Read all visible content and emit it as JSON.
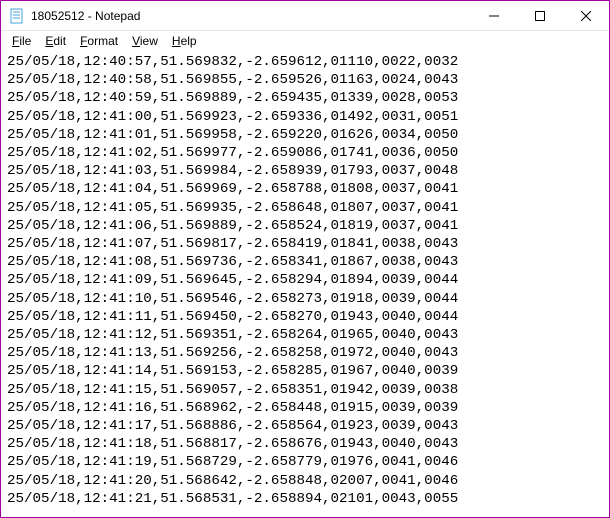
{
  "window": {
    "title": "18052512 - Notepad"
  },
  "menu": {
    "file": "File",
    "edit": "Edit",
    "format": "Format",
    "view": "View",
    "help": "Help"
  },
  "rows": [
    {
      "date": "25/05/18",
      "time": "12:40:57",
      "lat": "51.569832",
      "lon": "-2.659612",
      "c1": "01110",
      "c2": "0022",
      "c3": "0032"
    },
    {
      "date": "25/05/18",
      "time": "12:40:58",
      "lat": "51.569855",
      "lon": "-2.659526",
      "c1": "01163",
      "c2": "0024",
      "c3": "0043"
    },
    {
      "date": "25/05/18",
      "time": "12:40:59",
      "lat": "51.569889",
      "lon": "-2.659435",
      "c1": "01339",
      "c2": "0028",
      "c3": "0053"
    },
    {
      "date": "25/05/18",
      "time": "12:41:00",
      "lat": "51.569923",
      "lon": "-2.659336",
      "c1": "01492",
      "c2": "0031",
      "c3": "0051"
    },
    {
      "date": "25/05/18",
      "time": "12:41:01",
      "lat": "51.569958",
      "lon": "-2.659220",
      "c1": "01626",
      "c2": "0034",
      "c3": "0050"
    },
    {
      "date": "25/05/18",
      "time": "12:41:02",
      "lat": "51.569977",
      "lon": "-2.659086",
      "c1": "01741",
      "c2": "0036",
      "c3": "0050"
    },
    {
      "date": "25/05/18",
      "time": "12:41:03",
      "lat": "51.569984",
      "lon": "-2.658939",
      "c1": "01793",
      "c2": "0037",
      "c3": "0048"
    },
    {
      "date": "25/05/18",
      "time": "12:41:04",
      "lat": "51.569969",
      "lon": "-2.658788",
      "c1": "01808",
      "c2": "0037",
      "c3": "0041"
    },
    {
      "date": "25/05/18",
      "time": "12:41:05",
      "lat": "51.569935",
      "lon": "-2.658648",
      "c1": "01807",
      "c2": "0037",
      "c3": "0041"
    },
    {
      "date": "25/05/18",
      "time": "12:41:06",
      "lat": "51.569889",
      "lon": "-2.658524",
      "c1": "01819",
      "c2": "0037",
      "c3": "0041"
    },
    {
      "date": "25/05/18",
      "time": "12:41:07",
      "lat": "51.569817",
      "lon": "-2.658419",
      "c1": "01841",
      "c2": "0038",
      "c3": "0043"
    },
    {
      "date": "25/05/18",
      "time": "12:41:08",
      "lat": "51.569736",
      "lon": "-2.658341",
      "c1": "01867",
      "c2": "0038",
      "c3": "0043"
    },
    {
      "date": "25/05/18",
      "time": "12:41:09",
      "lat": "51.569645",
      "lon": "-2.658294",
      "c1": "01894",
      "c2": "0039",
      "c3": "0044"
    },
    {
      "date": "25/05/18",
      "time": "12:41:10",
      "lat": "51.569546",
      "lon": "-2.658273",
      "c1": "01918",
      "c2": "0039",
      "c3": "0044"
    },
    {
      "date": "25/05/18",
      "time": "12:41:11",
      "lat": "51.569450",
      "lon": "-2.658270",
      "c1": "01943",
      "c2": "0040",
      "c3": "0044"
    },
    {
      "date": "25/05/18",
      "time": "12:41:12",
      "lat": "51.569351",
      "lon": "-2.658264",
      "c1": "01965",
      "c2": "0040",
      "c3": "0043"
    },
    {
      "date": "25/05/18",
      "time": "12:41:13",
      "lat": "51.569256",
      "lon": "-2.658258",
      "c1": "01972",
      "c2": "0040",
      "c3": "0043"
    },
    {
      "date": "25/05/18",
      "time": "12:41:14",
      "lat": "51.569153",
      "lon": "-2.658285",
      "c1": "01967",
      "c2": "0040",
      "c3": "0039"
    },
    {
      "date": "25/05/18",
      "time": "12:41:15",
      "lat": "51.569057",
      "lon": "-2.658351",
      "c1": "01942",
      "c2": "0039",
      "c3": "0038"
    },
    {
      "date": "25/05/18",
      "time": "12:41:16",
      "lat": "51.568962",
      "lon": "-2.658448",
      "c1": "01915",
      "c2": "0039",
      "c3": "0039"
    },
    {
      "date": "25/05/18",
      "time": "12:41:17",
      "lat": "51.568886",
      "lon": "-2.658564",
      "c1": "01923",
      "c2": "0039",
      "c3": "0043"
    },
    {
      "date": "25/05/18",
      "time": "12:41:18",
      "lat": "51.568817",
      "lon": "-2.658676",
      "c1": "01943",
      "c2": "0040",
      "c3": "0043"
    },
    {
      "date": "25/05/18",
      "time": "12:41:19",
      "lat": "51.568729",
      "lon": "-2.658779",
      "c1": "01976",
      "c2": "0041",
      "c3": "0046"
    },
    {
      "date": "25/05/18",
      "time": "12:41:20",
      "lat": "51.568642",
      "lon": "-2.658848",
      "c1": "02007",
      "c2": "0041",
      "c3": "0046"
    },
    {
      "date": "25/05/18",
      "time": "12:41:21",
      "lat": "51.568531",
      "lon": "-2.658894",
      "c1": "02101",
      "c2": "0043",
      "c3": "0055"
    }
  ]
}
